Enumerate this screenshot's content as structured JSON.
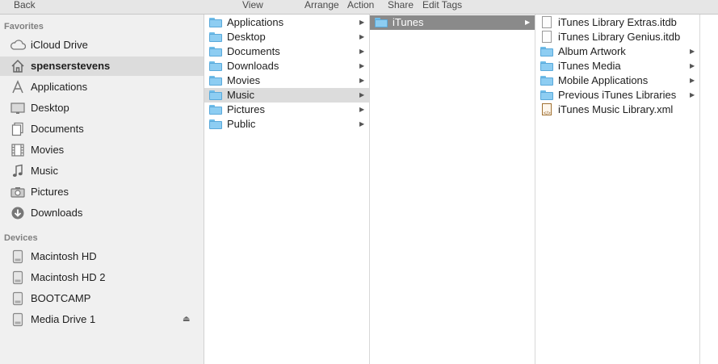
{
  "toolbar": {
    "back": "Back",
    "view": "View",
    "arrange": "Arrange",
    "action": "Action",
    "share": "Share",
    "edit_tags": "Edit Tags"
  },
  "sidebar": {
    "favorites_heading": "Favorites",
    "devices_heading": "Devices",
    "favorites": [
      {
        "label": "iCloud Drive",
        "icon": "cloud-icon"
      },
      {
        "label": "spenserstevens",
        "icon": "home-icon",
        "selected": true
      },
      {
        "label": "Applications",
        "icon": "applications-icon"
      },
      {
        "label": "Desktop",
        "icon": "desktop-icon"
      },
      {
        "label": "Documents",
        "icon": "documents-icon"
      },
      {
        "label": "Movies",
        "icon": "film-icon"
      },
      {
        "label": "Music",
        "icon": "music-note-icon"
      },
      {
        "label": "Pictures",
        "icon": "camera-icon"
      },
      {
        "label": "Downloads",
        "icon": "download-icon"
      }
    ],
    "devices": [
      {
        "label": "Macintosh HD",
        "icon": "hard-drive-icon"
      },
      {
        "label": "Macintosh HD 2",
        "icon": "hard-drive-icon"
      },
      {
        "label": "BOOTCAMP",
        "icon": "hard-drive-icon"
      },
      {
        "label": "Media Drive 1",
        "icon": "hard-drive-icon",
        "eject": true
      }
    ],
    "eject_glyph": "⏏"
  },
  "columns": [
    {
      "items": [
        {
          "label": "Applications",
          "kind": "folder",
          "has_children": true
        },
        {
          "label": "Desktop",
          "kind": "folder",
          "has_children": true
        },
        {
          "label": "Documents",
          "kind": "folder",
          "has_children": true
        },
        {
          "label": "Downloads",
          "kind": "folder",
          "has_children": true
        },
        {
          "label": "Movies",
          "kind": "folder",
          "has_children": true
        },
        {
          "label": "Music",
          "kind": "folder",
          "has_children": true,
          "selected": "grey"
        },
        {
          "label": "Pictures",
          "kind": "folder",
          "has_children": true
        },
        {
          "label": "Public",
          "kind": "folder",
          "has_children": true
        }
      ]
    },
    {
      "items": [
        {
          "label": "iTunes",
          "kind": "folder",
          "has_children": true,
          "selected": "dark"
        }
      ]
    },
    {
      "items": [
        {
          "label": "iTunes Library Extras.itdb",
          "kind": "document",
          "has_children": false
        },
        {
          "label": "iTunes Library Genius.itdb",
          "kind": "document",
          "has_children": false
        },
        {
          "label": "Album Artwork",
          "kind": "folder",
          "has_children": true
        },
        {
          "label": "iTunes Media",
          "kind": "folder",
          "has_children": true
        },
        {
          "label": "Mobile Applications",
          "kind": "folder",
          "has_children": true
        },
        {
          "label": "Previous iTunes Libraries",
          "kind": "folder",
          "has_children": true
        },
        {
          "label": "iTunes Music Library.xml",
          "kind": "xml-document",
          "has_children": false
        }
      ]
    }
  ],
  "arrow_glyph": "▶",
  "colors": {
    "folder": "#8dcdf2",
    "selection_grey": "#dcdcdc",
    "selection_dark": "#8a8a8a",
    "sidebar_bg": "#f0f0f0"
  }
}
